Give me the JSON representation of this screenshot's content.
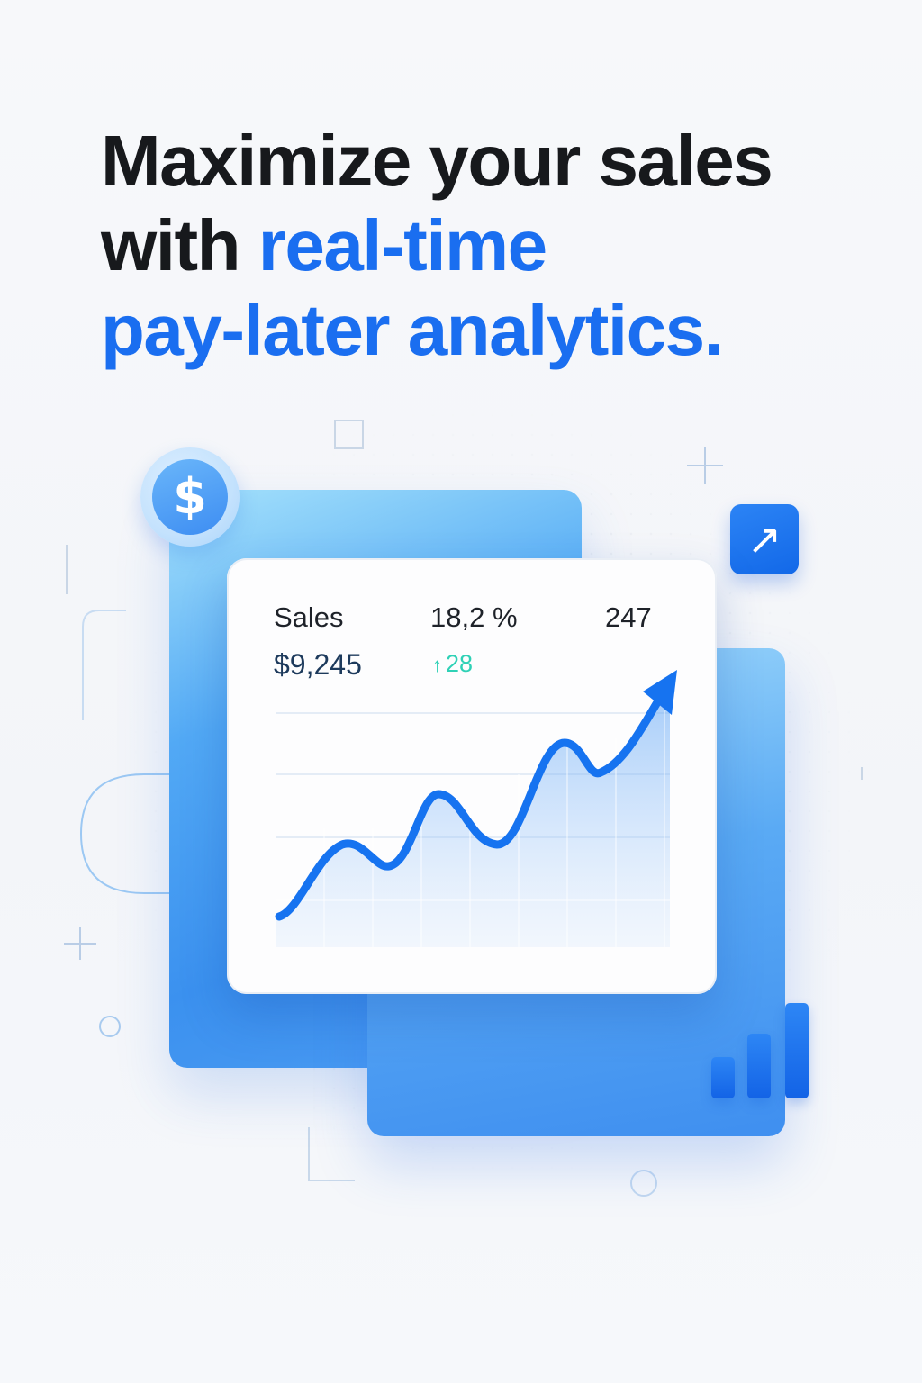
{
  "headline": {
    "line1": "Maximize your sales",
    "line2_plain": "with ",
    "line2_accent": "real-time",
    "line3_accent": "pay-later analytics."
  },
  "card": {
    "sales_label": "Sales",
    "sales_value": "$9,245",
    "percent": "18,2 %",
    "delta": "28",
    "delta_icon": "arrow-up-icon",
    "count": "247"
  },
  "badges": {
    "dollar_symbol": "$",
    "dollar_icon": "dollar-coin-icon",
    "trend_arrow": "↗",
    "trend_icon": "arrow-up-right-icon",
    "mini_chart_icon": "bar-chart-icon"
  },
  "colors": {
    "accent": "#1a6ef0",
    "headline_text": "#17191c",
    "positive_delta": "#2fd1b6",
    "line": "#1673f0"
  }
}
